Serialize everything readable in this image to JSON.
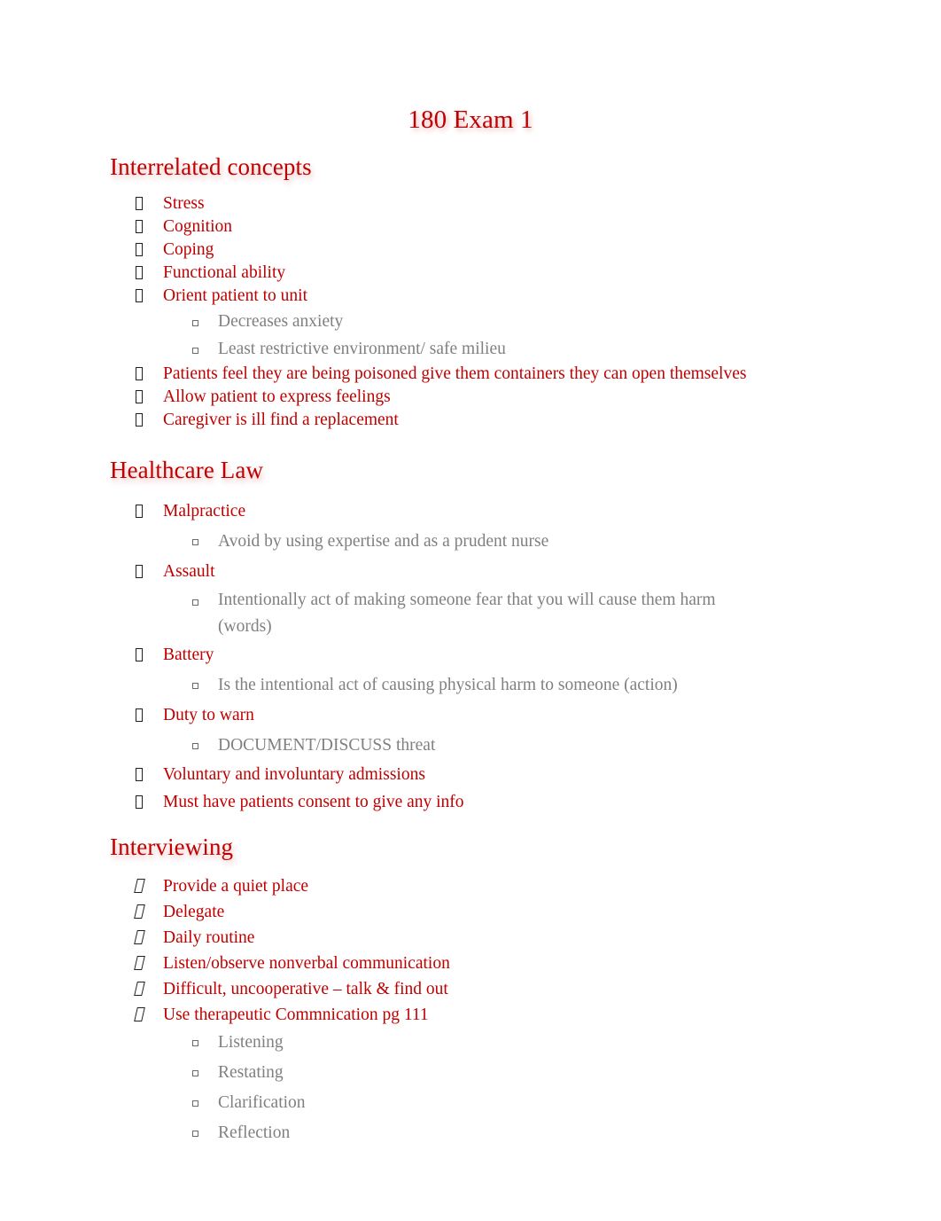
{
  "document": {
    "title": "180 Exam 1",
    "colors": {
      "heading_red": "#c00000",
      "body_red": "#c00000",
      "subtext_gray": "#808080",
      "background": "#ffffff",
      "bullet_outline": "#1f1f1f"
    },
    "bullet_glyphs": {
      "level1_box": "missing-glyph-box",
      "level1_box_italic": "missing-glyph-box-italic",
      "level2_square": "hollow-square"
    }
  },
  "sections": [
    {
      "heading": "Interrelated concepts",
      "items": [
        {
          "level": 1,
          "text": "Stress"
        },
        {
          "level": 1,
          "text": "Cognition"
        },
        {
          "level": 1,
          "text": "Coping"
        },
        {
          "level": 1,
          "text": "Functional ability"
        },
        {
          "level": 1,
          "text": "Orient patient to unit"
        },
        {
          "level": 2,
          "text": "Decreases anxiety"
        },
        {
          "level": 2,
          "text": "Least restrictive environment/ safe milieu"
        },
        {
          "level": 1,
          "text": "Patients feel they are being poisoned give them containers they can open themselves"
        },
        {
          "level": 1,
          "text": "Allow patient to express feelings"
        },
        {
          "level": 1,
          "text": "Caregiver is ill find a replacement"
        }
      ]
    },
    {
      "heading": "Healthcare Law",
      "items": [
        {
          "level": 1,
          "text": "Malpractice"
        },
        {
          "level": 2,
          "text": "Avoid by using expertise and as a prudent nurse"
        },
        {
          "level": 1,
          "text": "Assault"
        },
        {
          "level": 2,
          "text": "Intentionally act of making someone fear that you will cause them harm (words)"
        },
        {
          "level": 1,
          "text": "Battery"
        },
        {
          "level": 2,
          "text": "Is the intentional act of causing physical harm to someone (action)"
        },
        {
          "level": 1,
          "text": "Duty to warn"
        },
        {
          "level": 2,
          "text": "DOCUMENT/DISCUSS threat"
        },
        {
          "level": 1,
          "text": "Voluntary and involuntary admissions"
        },
        {
          "level": 1,
          "text": "Must have patients consent to give any info"
        }
      ]
    },
    {
      "heading": "Interviewing",
      "items": [
        {
          "level": 1,
          "text": "Provide a quiet place"
        },
        {
          "level": 1,
          "text": "Delegate"
        },
        {
          "level": 1,
          "text": "Daily routine"
        },
        {
          "level": 1,
          "text": "Listen/observe nonverbal communication"
        },
        {
          "level": 1,
          "text": "Difficult, uncooperative – talk & find out"
        },
        {
          "level": 1,
          "text": "Use therapeutic Commnication pg 111"
        },
        {
          "level": 2,
          "text": "Listening"
        },
        {
          "level": 2,
          "text": "Restating"
        },
        {
          "level": 2,
          "text": "Clarification"
        },
        {
          "level": 2,
          "text": "Reflection"
        }
      ]
    }
  ]
}
